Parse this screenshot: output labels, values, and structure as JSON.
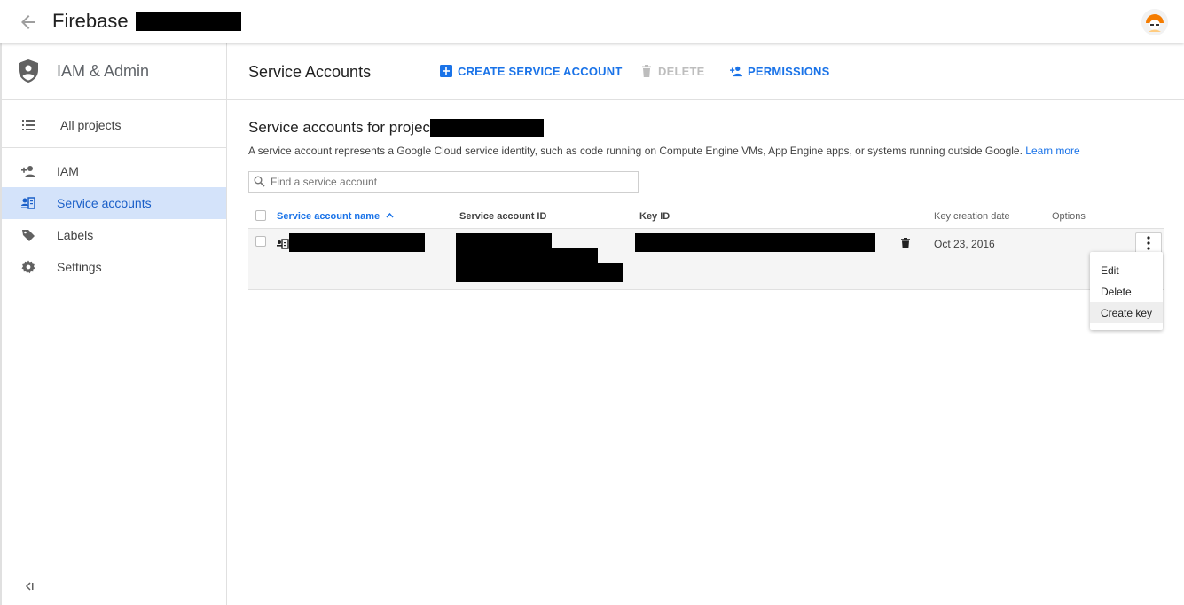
{
  "appbar": {
    "title": "Firebase",
    "back_icon": "arrow-back-icon",
    "avatar_icon": "user-avatar-icon"
  },
  "sidebar": {
    "title": "IAM & Admin",
    "all_projects": "All projects",
    "items": [
      {
        "label": "IAM",
        "icon": "person-add-icon"
      },
      {
        "label": "Service accounts",
        "icon": "service-account-icon",
        "active": true
      },
      {
        "label": "Labels",
        "icon": "label-icon"
      },
      {
        "label": "Settings",
        "icon": "gear-icon"
      }
    ]
  },
  "toolbar": {
    "page_title": "Service Accounts",
    "create_label": "CREATE SERVICE ACCOUNT",
    "delete_label": "DELETE",
    "permissions_label": "PERMISSIONS"
  },
  "content": {
    "section_title": "Service accounts for project",
    "description": "A service account represents a Google Cloud service identity, such as code running on Compute Engine VMs, App Engine apps, or systems running outside Google.",
    "learn_more": "Learn more",
    "search_placeholder": "Find a service account"
  },
  "table": {
    "columns": {
      "name": "Service account name",
      "id": "Service account ID",
      "key_id": "Key ID",
      "created": "Key creation date",
      "options": "Options"
    },
    "rows": [
      {
        "created": "Oct 23, 2016"
      }
    ]
  },
  "menu": {
    "items": [
      "Edit",
      "Delete",
      "Create key"
    ]
  },
  "colors": {
    "accent": "#1a73e8",
    "active_bg": "#d4e3fa"
  }
}
